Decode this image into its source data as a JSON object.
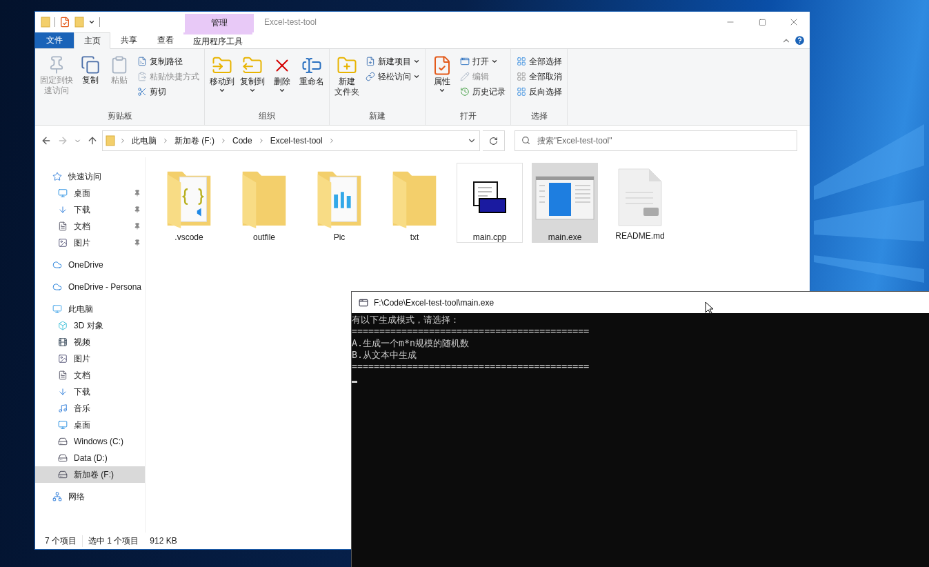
{
  "explorer": {
    "title_bar": {
      "context_header": "管理",
      "title": "Excel-test-tool"
    },
    "tabs": [
      {
        "label": "文件",
        "kind": "file",
        "selected": false
      },
      {
        "label": "主页",
        "kind": "plain",
        "selected": true
      },
      {
        "label": "共享",
        "kind": "plain",
        "selected": false
      },
      {
        "label": "查看",
        "kind": "plain",
        "selected": false
      },
      {
        "label": "应用程序工具",
        "kind": "context",
        "selected": false
      }
    ],
    "ribbon": [
      {
        "label": "剪贴板",
        "items": [
          {
            "lines": [
              "固定到快",
              "速访问"
            ],
            "kind": "large",
            "disabled": true,
            "dropdown": false
          },
          {
            "label": "复制",
            "kind": "large",
            "disabled": false,
            "dropdown": false
          },
          {
            "label": "粘贴",
            "kind": "large",
            "disabled": true,
            "dropdown": false
          },
          {
            "label": "复制路径",
            "kind": "small",
            "disabled": false,
            "dropdown": false
          },
          {
            "label": "粘贴快捷方式",
            "kind": "small",
            "disabled": true,
            "dropdown": false
          },
          {
            "label": "剪切",
            "kind": "small",
            "disabled": false,
            "dropdown": false
          }
        ]
      },
      {
        "label": "组织",
        "items": [
          {
            "label": "移动到",
            "kind": "large",
            "disabled": false,
            "dropdown": true
          },
          {
            "label": "复制到",
            "kind": "large",
            "disabled": false,
            "dropdown": true
          },
          {
            "label": "删除",
            "kind": "large",
            "disabled": false,
            "dropdown": true
          },
          {
            "label": "重命名",
            "kind": "large",
            "disabled": false,
            "dropdown": false
          }
        ]
      },
      {
        "label": "新建",
        "items": [
          {
            "lines": [
              "新建",
              "文件夹"
            ],
            "kind": "large",
            "disabled": false,
            "dropdown": false
          },
          {
            "label": "新建项目",
            "kind": "small",
            "disabled": false,
            "dropdown": true
          },
          {
            "label": "轻松访问",
            "kind": "small",
            "disabled": false,
            "dropdown": true
          }
        ]
      },
      {
        "label": "打开",
        "items": [
          {
            "label": "属性",
            "kind": "large",
            "disabled": false,
            "dropdown": true
          },
          {
            "label": "打开",
            "kind": "small",
            "disabled": false,
            "dropdown": true
          },
          {
            "label": "编辑",
            "kind": "small",
            "disabled": true,
            "dropdown": false
          },
          {
            "label": "历史记录",
            "kind": "small",
            "disabled": false,
            "dropdown": false
          }
        ]
      },
      {
        "label": "选择",
        "items": [
          {
            "label": "全部选择",
            "kind": "small",
            "disabled": false,
            "dropdown": false
          },
          {
            "label": "全部取消",
            "kind": "small",
            "disabled": false,
            "dropdown": false
          },
          {
            "label": "反向选择",
            "kind": "small",
            "disabled": false,
            "dropdown": false
          }
        ]
      }
    ],
    "address": {
      "crumbs": [
        "此电脑",
        "新加卷 (F:)",
        "Code",
        "Excel-test-tool"
      ]
    },
    "search": {
      "placeholder": "搜索\"Excel-test-tool\""
    },
    "nav": [
      {
        "label": "快速访问",
        "selected": false,
        "children": [
          {
            "label": "桌面",
            "selected": false,
            "pinned": true
          },
          {
            "label": "下载",
            "selected": false,
            "pinned": true
          },
          {
            "label": "文档",
            "selected": false,
            "pinned": true
          },
          {
            "label": "图片",
            "selected": false,
            "pinned": true
          }
        ]
      },
      {
        "label": "OneDrive",
        "selected": false
      },
      {
        "label": "OneDrive - Persona",
        "selected": false
      },
      {
        "label": "此电脑",
        "selected": false,
        "children": [
          {
            "label": "3D 对象",
            "selected": false
          },
          {
            "label": "视频",
            "selected": false
          },
          {
            "label": "图片",
            "selected": false
          },
          {
            "label": "文档",
            "selected": false
          },
          {
            "label": "下载",
            "selected": false
          },
          {
            "label": "音乐",
            "selected": false
          },
          {
            "label": "桌面",
            "selected": false
          },
          {
            "label": "Windows (C:)",
            "selected": false
          },
          {
            "label": "Data (D:)",
            "selected": false
          },
          {
            "label": "新加卷 (F:)",
            "selected": true
          }
        ]
      },
      {
        "label": "网络",
        "selected": false
      }
    ],
    "files": [
      {
        "name": ".vscode",
        "selected": false,
        "focused": false
      },
      {
        "name": "outfile",
        "selected": false,
        "focused": false
      },
      {
        "name": "Pic",
        "selected": false,
        "focused": false
      },
      {
        "name": "txt",
        "selected": false,
        "focused": false
      },
      {
        "name": "main.cpp",
        "selected": false,
        "focused": true
      },
      {
        "name": "main.exe",
        "selected": true,
        "focused": false
      },
      {
        "name": "README.md",
        "selected": false,
        "focused": false
      }
    ],
    "status_bar": [
      "7 个项目",
      "选中 1 个项目",
      "912 KB"
    ]
  },
  "console": {
    "title": "F:\\Code\\Excel-test-tool\\main.exe",
    "lines": [
      "有以下生成模式，请选择：",
      "===========================================",
      "A.生成一个m*n规模的随机数",
      "B.从文本中生成",
      "==========================================="
    ]
  }
}
